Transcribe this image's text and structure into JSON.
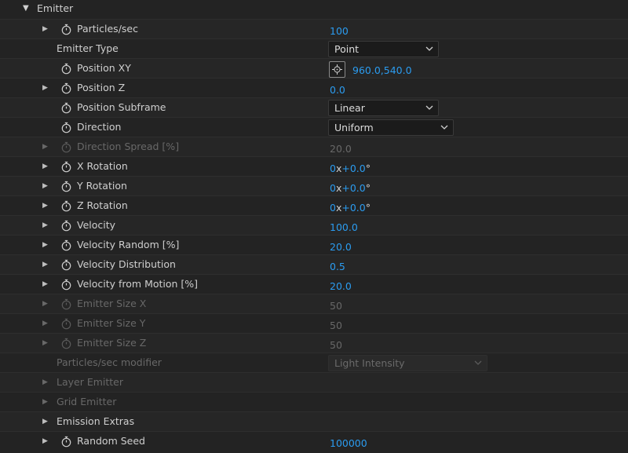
{
  "group": {
    "label": "Emitter"
  },
  "rows": {
    "particles_sec": {
      "label": "Particles/sec",
      "value": "100"
    },
    "emitter_type": {
      "label": "Emitter Type",
      "selected": "Point"
    },
    "position_xy": {
      "label": "Position XY",
      "value": "960.0,540.0"
    },
    "position_z": {
      "label": "Position Z",
      "value": "0.0"
    },
    "position_subframe": {
      "label": "Position Subframe",
      "selected": "Linear"
    },
    "direction": {
      "label": "Direction",
      "selected": "Uniform"
    },
    "direction_spread": {
      "label": "Direction Spread [%]",
      "value": "20.0"
    },
    "x_rotation": {
      "label": "X Rotation",
      "turns": "0",
      "x": "x",
      "degrees": "+0.0",
      "deg_sign": "°"
    },
    "y_rotation": {
      "label": "Y Rotation",
      "turns": "0",
      "x": "x",
      "degrees": "+0.0",
      "deg_sign": "°"
    },
    "z_rotation": {
      "label": "Z Rotation",
      "turns": "0",
      "x": "x",
      "degrees": "+0.0",
      "deg_sign": "°"
    },
    "velocity": {
      "label": "Velocity",
      "value": "100.0"
    },
    "velocity_random": {
      "label": "Velocity Random [%]",
      "value": "20.0"
    },
    "velocity_distribution": {
      "label": "Velocity Distribution",
      "value": "0.5"
    },
    "velocity_from_motion": {
      "label": "Velocity from Motion [%]",
      "value": "20.0"
    },
    "emitter_size_x": {
      "label": "Emitter Size X",
      "value": "50"
    },
    "emitter_size_y": {
      "label": "Emitter Size Y",
      "value": "50"
    },
    "emitter_size_z": {
      "label": "Emitter Size Z",
      "value": "50"
    },
    "particles_sec_modifier": {
      "label": "Particles/sec modifier",
      "selected": "Light Intensity"
    },
    "layer_emitter": {
      "label": "Layer Emitter"
    },
    "grid_emitter": {
      "label": "Grid Emitter"
    },
    "emission_extras": {
      "label": "Emission Extras"
    },
    "random_seed": {
      "label": "Random Seed",
      "value": "100000"
    }
  },
  "colors": {
    "background": "#232323",
    "value_blue": "#2b9cf0",
    "disabled_text": "#686868"
  },
  "icons": {
    "expand": "triangle-right-icon",
    "collapse": "triangle-down-icon",
    "stopwatch": "stopwatch-icon",
    "crosshair": "crosshair-icon",
    "dropdown": "chevron-down-icon"
  }
}
